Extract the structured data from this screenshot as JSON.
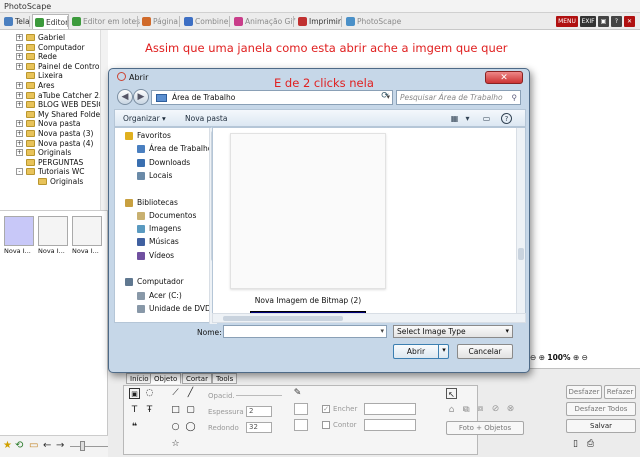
{
  "window": {
    "title": "PhotoScape"
  },
  "tabs": [
    {
      "label": "Tela",
      "color": "#4a7fc0",
      "active": false,
      "dim": false
    },
    {
      "label": "Editor",
      "color": "#3c9a3c",
      "active": true,
      "dim": false
    },
    {
      "label": "Editor em lotes",
      "color": "#3c9a3c",
      "active": false,
      "dim": true
    },
    {
      "label": "Página",
      "color": "#d06a2a",
      "active": false,
      "dim": true
    },
    {
      "label": "Combine",
      "color": "#3d6fc4",
      "active": false,
      "dim": true
    },
    {
      "label": "Animação Gif",
      "color": "#c93d8a",
      "active": false,
      "dim": true
    },
    {
      "label": "Imprimir",
      "color": "#c03030",
      "active": false,
      "dim": false
    },
    {
      "label": "PhotoScape",
      "color": "#4a90c8",
      "active": false,
      "dim": true
    }
  ],
  "top_right_icons": [
    {
      "label": "MENU",
      "color": "#b01010"
    },
    {
      "label": "EXIF",
      "color": "#333333"
    },
    {
      "label": "▣",
      "color": "#444444"
    },
    {
      "label": "?",
      "color": "#444444"
    },
    {
      "label": "✕",
      "color": "#b01010"
    }
  ],
  "folder_tree": [
    {
      "label": "Gabriel",
      "expander": "+"
    },
    {
      "label": "Computador",
      "expander": "+"
    },
    {
      "label": "Rede",
      "expander": "+"
    },
    {
      "label": "Painel de Controle",
      "expander": "+"
    },
    {
      "label": "Lixeira",
      "expander": ""
    },
    {
      "label": "Ares",
      "expander": "+"
    },
    {
      "label": "aTube Catcher 2.0",
      "expander": "+"
    },
    {
      "label": "BLOG WEB DESIGN",
      "expander": "+"
    },
    {
      "label": "My Shared Folder",
      "expander": ""
    },
    {
      "label": "Nova pasta",
      "expander": "+"
    },
    {
      "label": "Nova pasta (3)",
      "expander": "+"
    },
    {
      "label": "Nova pasta (4)",
      "expander": "+"
    },
    {
      "label": "Originals",
      "expander": "+"
    },
    {
      "label": "PERGUNTAS",
      "expander": ""
    },
    {
      "label": "Tutoriais WC",
      "expander": "-"
    },
    {
      "label": "Originals",
      "expander": "",
      "indent": true
    }
  ],
  "thumbnails": [
    {
      "label": "Nova I...",
      "fill": "#c8c8f8"
    },
    {
      "label": "Nova I...",
      "fill": "#f4f4f4"
    },
    {
      "label": "Nova I...",
      "fill": "#f4f4f4"
    }
  ],
  "annotations": {
    "top": "Assim que uma janela como esta abrir ache a imgem que quer",
    "dialog": "E de 2 clicks nela"
  },
  "dialog": {
    "title": "Abrir",
    "address": "Área de Trabalho",
    "search_placeholder": "Pesquisar Área de Trabalho",
    "organize": "Organizar ▾",
    "new_folder": "Nova pasta",
    "nav": [
      {
        "label": "Favoritos",
        "indent": 0,
        "color": "#e0b020"
      },
      {
        "label": "Área de Trabalho",
        "indent": 1,
        "color": "#4a7fc0"
      },
      {
        "label": "Downloads",
        "indent": 1,
        "color": "#3a6fb0"
      },
      {
        "label": "Locais",
        "indent": 1,
        "color": "#6a8aa8"
      },
      {
        "label": "",
        "indent": 0,
        "color": ""
      },
      {
        "label": "Bibliotecas",
        "indent": 0,
        "color": "#c8a040"
      },
      {
        "label": "Documentos",
        "indent": 1,
        "color": "#c8b070"
      },
      {
        "label": "Imagens",
        "indent": 1,
        "color": "#5a9ac0"
      },
      {
        "label": "Músicas",
        "indent": 1,
        "color": "#4060a0"
      },
      {
        "label": "Vídeos",
        "indent": 1,
        "color": "#7050a0"
      },
      {
        "label": "",
        "indent": 0,
        "color": ""
      },
      {
        "label": "Computador",
        "indent": 0,
        "color": "#607890"
      },
      {
        "label": "Acer (C:)",
        "indent": 1,
        "color": "#8898a8"
      },
      {
        "label": "Unidade de DVD",
        "indent": 1,
        "color": "#8898a8"
      }
    ],
    "file_name": "Nova Imagem de Bitmap (2)",
    "name_label": "Nome:",
    "name_value": "",
    "type_select": "Select Image Type",
    "open_button": "Abrir",
    "cancel_button": "Cancelar"
  },
  "zoom": {
    "value": "100%"
  },
  "editor": {
    "tabs": [
      "Início",
      "Objeto",
      "Cortar",
      "Tools"
    ],
    "active_tab": "Objeto",
    "opacity_label": "Opacid.",
    "thickness_label": "Espessura",
    "thickness_value": "2",
    "round_label": "Redondo",
    "round_value": "32",
    "fill_label": "Encher",
    "outline_label": "Contor",
    "photo_objects_button": "Foto + Objetos",
    "undo_button": "Desfazer",
    "redo_button": "Refazer",
    "undo_all_button": "Desfazer Todos",
    "save_button": "Salvar"
  }
}
